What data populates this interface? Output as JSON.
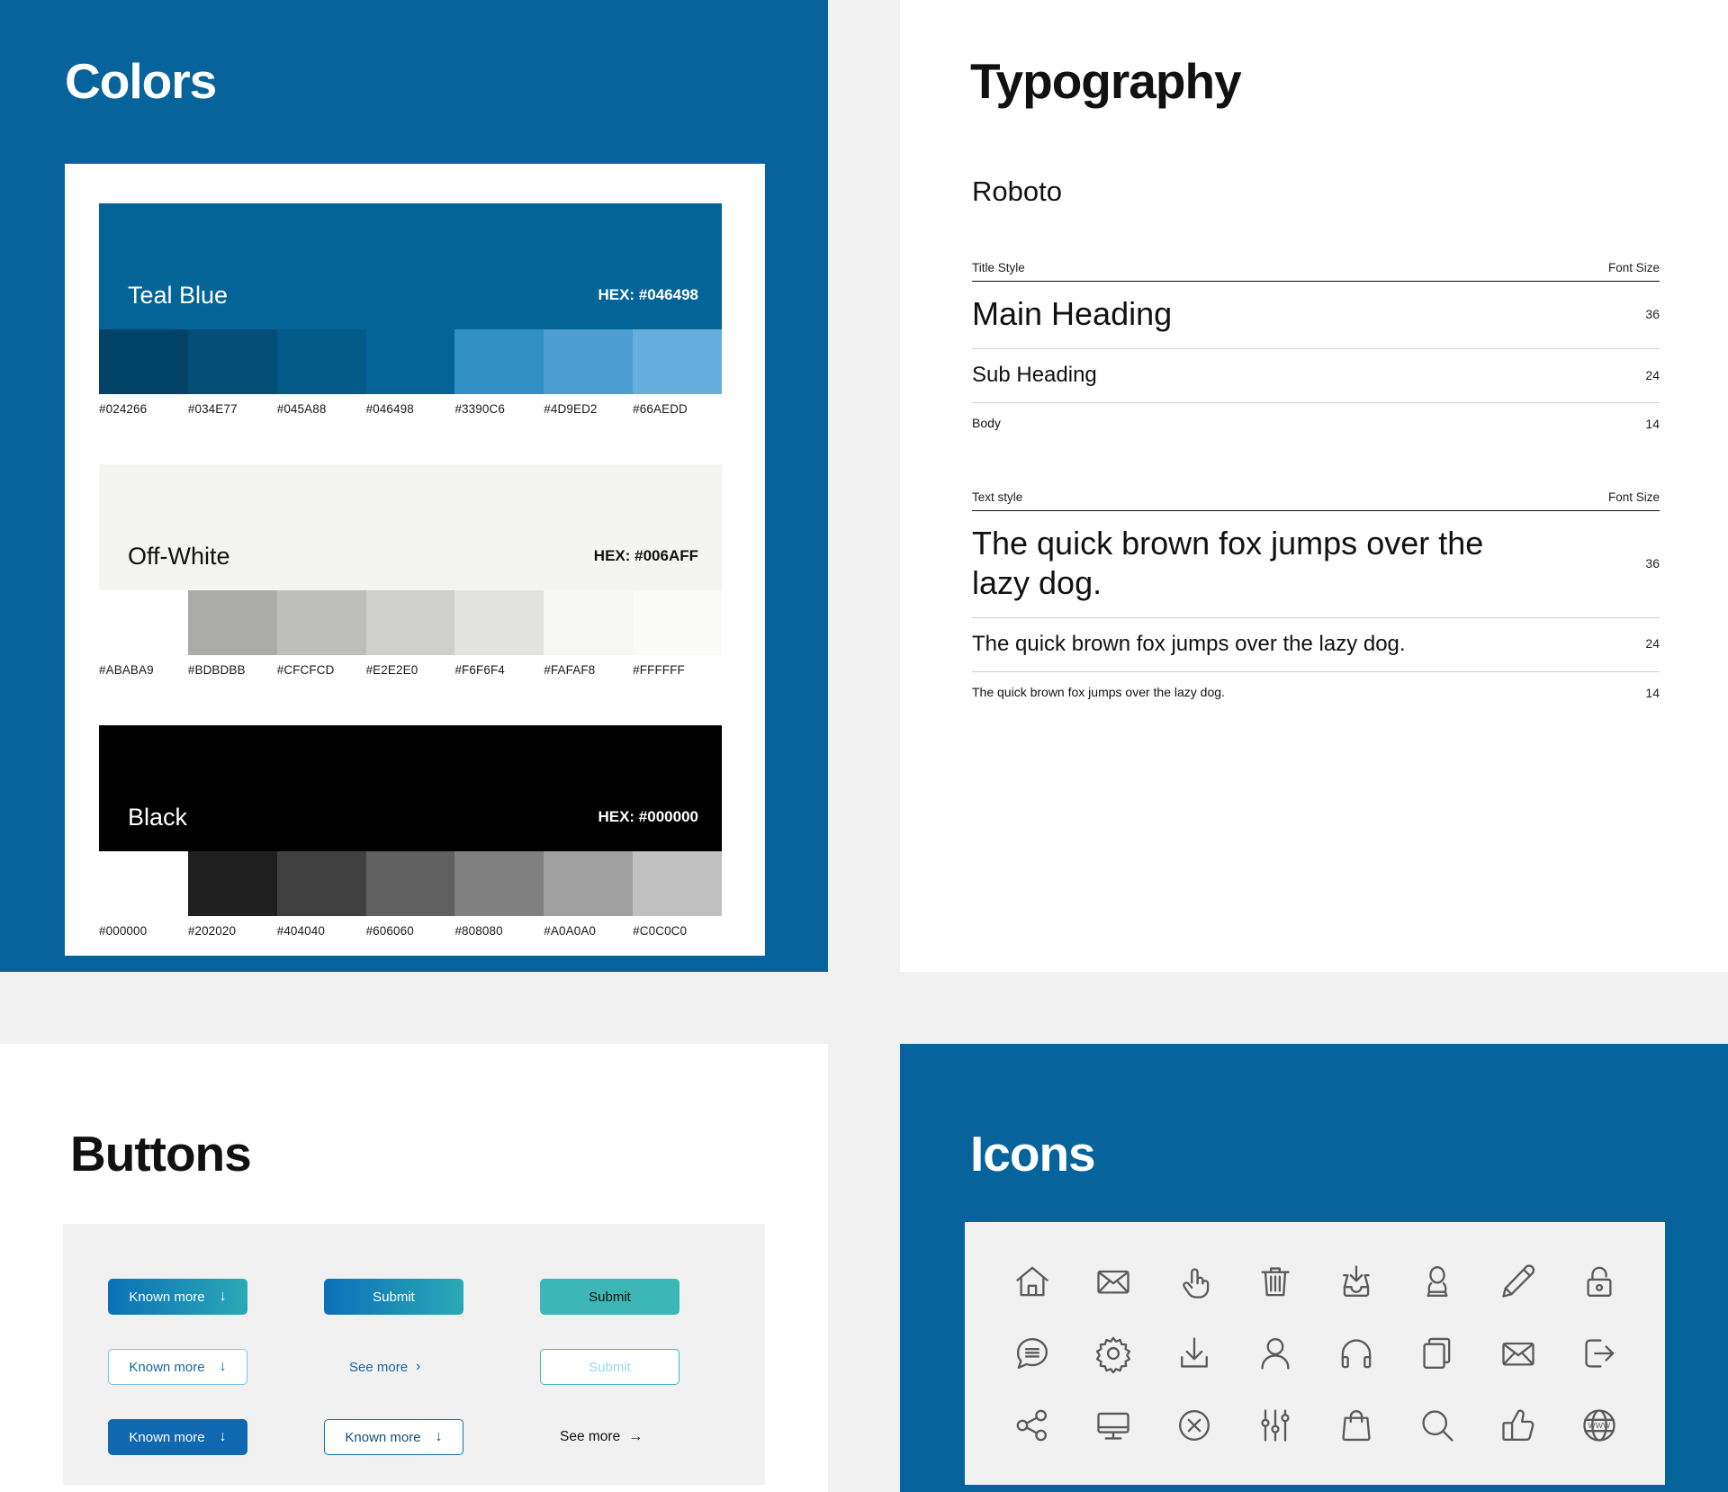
{
  "sections": {
    "colors": {
      "title": "Colors"
    },
    "typography": {
      "title": "Typography"
    },
    "buttons": {
      "title": "Buttons"
    },
    "icons": {
      "title": "Icons"
    }
  },
  "colors": {
    "palettes": [
      {
        "name": "Teal Blue",
        "hex_label": "HEX: #046498",
        "header_color": "#046498",
        "indent": false,
        "swatches": [
          {
            "hex": "#024266"
          },
          {
            "hex": "#034E77"
          },
          {
            "hex": "#045A88"
          },
          {
            "hex": "#046498"
          },
          {
            "hex": "#3390C6"
          },
          {
            "hex": "#4D9ED2"
          },
          {
            "hex": "#66AEDD"
          }
        ]
      },
      {
        "name": "Off-White",
        "hex_label": "HEX: #006AFF",
        "header_color": "#F4F4F2",
        "indent": true,
        "swatches": [
          {
            "hex": "#ABABA9"
          },
          {
            "hex": "#BDBDBB"
          },
          {
            "hex": "#CFCFCD"
          },
          {
            "hex": "#E2E2E0"
          },
          {
            "hex": "#F6F6F4"
          },
          {
            "hex": "#FAFAF8"
          },
          {
            "hex": "#FFFFFF"
          }
        ]
      },
      {
        "name": "Black",
        "hex_label": "HEX: #000000",
        "header_color": "#000000",
        "indent": true,
        "swatches": [
          {
            "hex": "#000000"
          },
          {
            "hex": "#202020"
          },
          {
            "hex": "#404040"
          },
          {
            "hex": "#606060"
          },
          {
            "hex": "#808080"
          },
          {
            "hex": "#A0A0A0"
          },
          {
            "hex": "#C0C0C0"
          }
        ]
      }
    ]
  },
  "typography": {
    "font_name": "Roboto",
    "tables": [
      {
        "col_style": "Title Style",
        "col_size": "Font Size",
        "rows": [
          {
            "sample": "Main Heading",
            "size": "36"
          },
          {
            "sample": "Sub Heading",
            "size": "24"
          },
          {
            "sample": "Body",
            "size": "14"
          }
        ]
      },
      {
        "col_style": "Text style",
        "col_size": "Font Size",
        "rows": [
          {
            "sample": "The quick brown fox jumps over the lazy dog.",
            "size": "36"
          },
          {
            "sample": "The quick brown fox jumps over the lazy dog.",
            "size": "24"
          },
          {
            "sample": "The quick brown fox jumps over the lazy dog.",
            "size": "14"
          }
        ]
      }
    ]
  },
  "buttons": {
    "items": [
      {
        "label": "Known more",
        "icon": "arrow-down-icon",
        "glyph": "↓",
        "variant": "grad-blue-teal"
      },
      {
        "label": "Submit",
        "icon": "",
        "glyph": "",
        "variant": "grad-blue-teal-plain"
      },
      {
        "label": "Submit",
        "icon": "",
        "glyph": "",
        "variant": "teal-solid"
      },
      {
        "label": "Known more",
        "icon": "arrow-down-icon",
        "glyph": "↓",
        "variant": "outline-grad"
      },
      {
        "label": "See more",
        "icon": "chevron-right-icon",
        "glyph": "›",
        "variant": "link-blue"
      },
      {
        "label": "Submit",
        "icon": "",
        "glyph": "",
        "variant": "teal-outline"
      },
      {
        "label": "Known more",
        "icon": "arrow-down-icon",
        "glyph": "↓",
        "variant": "solid-blue"
      },
      {
        "label": "Known more",
        "icon": "arrow-down-icon",
        "glyph": "↓",
        "variant": "outline-blue"
      },
      {
        "label": "See more",
        "icon": "arrow-right-icon",
        "glyph": "→",
        "variant": "link-dark"
      }
    ]
  },
  "icons": {
    "items": [
      "home-icon",
      "envelope-icon",
      "pointing-hand-icon",
      "trash-icon",
      "inbox-download-icon",
      "user-female-icon",
      "pencil-icon",
      "lock-icon",
      "chat-message-icon",
      "gear-icon",
      "download-icon",
      "user-icon",
      "headphones-icon",
      "copy-icon",
      "mail-icon",
      "logout-icon",
      "share-icon",
      "monitor-icon",
      "close-circle-icon",
      "sliders-icon",
      "shopping-bag-icon",
      "search-icon",
      "thumbs-up-icon",
      "globe-www-icon"
    ]
  },
  "theme": {
    "brand_blue": "#06639b",
    "panel_gray": "#f1f1f1",
    "card_gray": "#f1f1f1",
    "accent_teal": "#3cb6b6"
  }
}
